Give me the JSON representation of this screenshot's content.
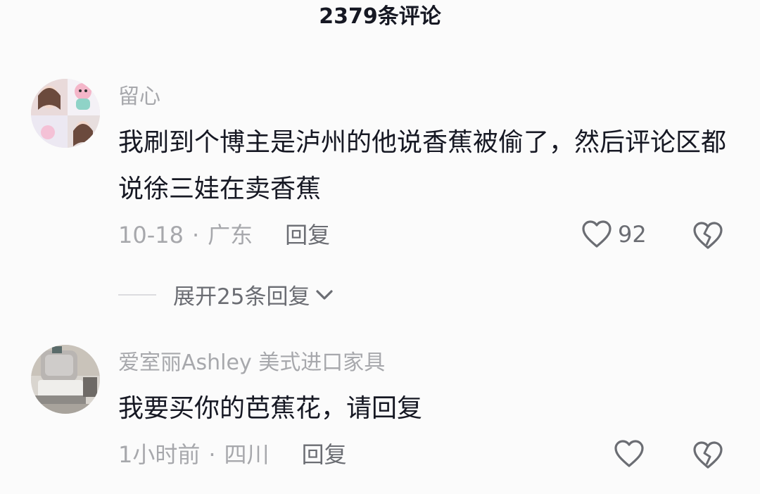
{
  "header": {
    "title": "2379条评论"
  },
  "comments": [
    {
      "username": "留心",
      "text": "我刷到个博主是泸州的他说香蕉被偷了，然后评论区都说徐三娃在卖香蕉",
      "date": "10-18",
      "separator": "·",
      "location": "广东",
      "reply_label": "回复",
      "like_count": "92",
      "expand_label": "展开25条回复"
    },
    {
      "username": "爱室丽Ashley 美式进口家具",
      "text": "我要买你的芭蕉花，请回复",
      "date": "1小时前",
      "separator": "·",
      "location": "四川",
      "reply_label": "回复",
      "like_count": ""
    }
  ],
  "icons": {
    "like": "heart-outline-icon",
    "dislike": "broken-heart-icon",
    "expand": "chevron-down-icon"
  },
  "colors": {
    "background": "#fbfbfb",
    "text_primary": "#161823",
    "text_secondary": "#a7a8ac",
    "text_action": "#6b6d73"
  }
}
